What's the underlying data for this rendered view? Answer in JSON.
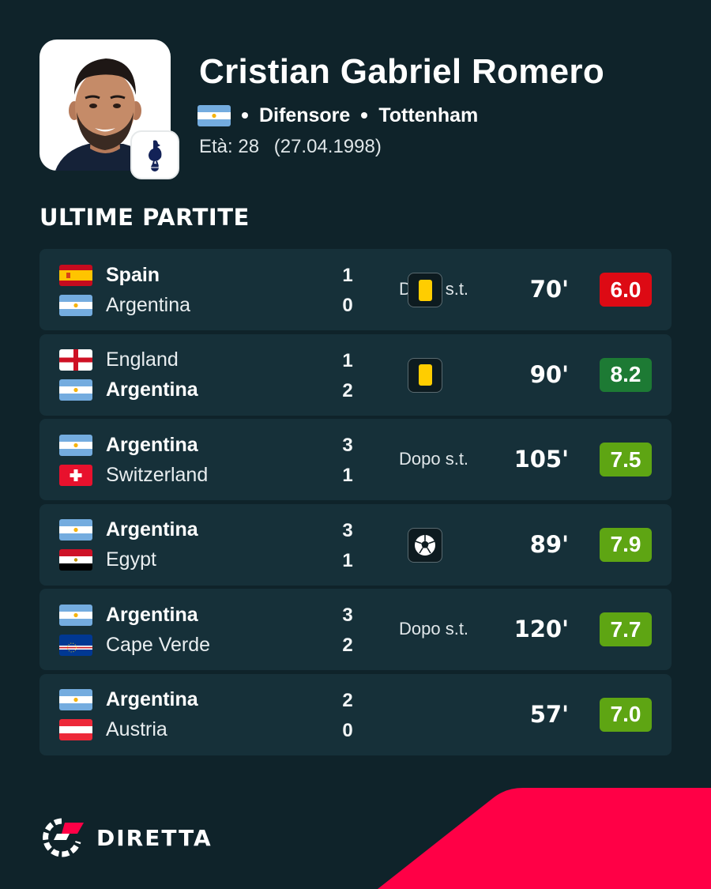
{
  "player": {
    "name": "Cristian Gabriel Romero",
    "nationality_flag": "argentina",
    "position": "Difensore",
    "club": "Tottenham",
    "club_badge_icon": "tottenham-cockerel-icon",
    "age_label": "Età: 28",
    "birth_date": "(27.04.1998)"
  },
  "section_title": "ULTIME PARTITE",
  "matches": [
    {
      "home": {
        "name": "Spain",
        "flag": "spain",
        "score": "1",
        "bold": true
      },
      "away": {
        "name": "Argentina",
        "flag": "argentina",
        "score": "0",
        "bold": false
      },
      "note": "Dopo s.t.",
      "event": "yellow-card",
      "minutes": "70'",
      "rating": "6.0",
      "rating_color": "#dd0a14"
    },
    {
      "home": {
        "name": "England",
        "flag": "england",
        "score": "1",
        "bold": false
      },
      "away": {
        "name": "Argentina",
        "flag": "argentina",
        "score": "2",
        "bold": true
      },
      "note": "",
      "event": "yellow-card",
      "minutes": "90'",
      "rating": "8.2",
      "rating_color": "#1d7a34"
    },
    {
      "home": {
        "name": "Argentina",
        "flag": "argentina",
        "score": "3",
        "bold": true
      },
      "away": {
        "name": "Switzerland",
        "flag": "switzerland",
        "score": "1",
        "bold": false
      },
      "note": "Dopo s.t.",
      "event": "",
      "minutes": "105'",
      "rating": "7.5",
      "rating_color": "#5ea513"
    },
    {
      "home": {
        "name": "Argentina",
        "flag": "argentina",
        "score": "3",
        "bold": true
      },
      "away": {
        "name": "Egypt",
        "flag": "egypt",
        "score": "1",
        "bold": false
      },
      "note": "",
      "event": "goal",
      "minutes": "89'",
      "rating": "7.9",
      "rating_color": "#5ea513"
    },
    {
      "home": {
        "name": "Argentina",
        "flag": "argentina",
        "score": "3",
        "bold": true
      },
      "away": {
        "name": "Cape Verde",
        "flag": "cape-verde",
        "score": "2",
        "bold": false
      },
      "note": "Dopo s.t.",
      "event": "",
      "minutes": "120'",
      "rating": "7.7",
      "rating_color": "#5ea513"
    },
    {
      "home": {
        "name": "Argentina",
        "flag": "argentina",
        "score": "2",
        "bold": true
      },
      "away": {
        "name": "Austria",
        "flag": "austria",
        "score": "0",
        "bold": false
      },
      "note": "",
      "event": "",
      "minutes": "57'",
      "rating": "7.0",
      "rating_color": "#5ea513"
    }
  ],
  "brand": {
    "name": "DIRETTA",
    "accent_color": "#ff0046",
    "background_color": "#0f232a"
  }
}
